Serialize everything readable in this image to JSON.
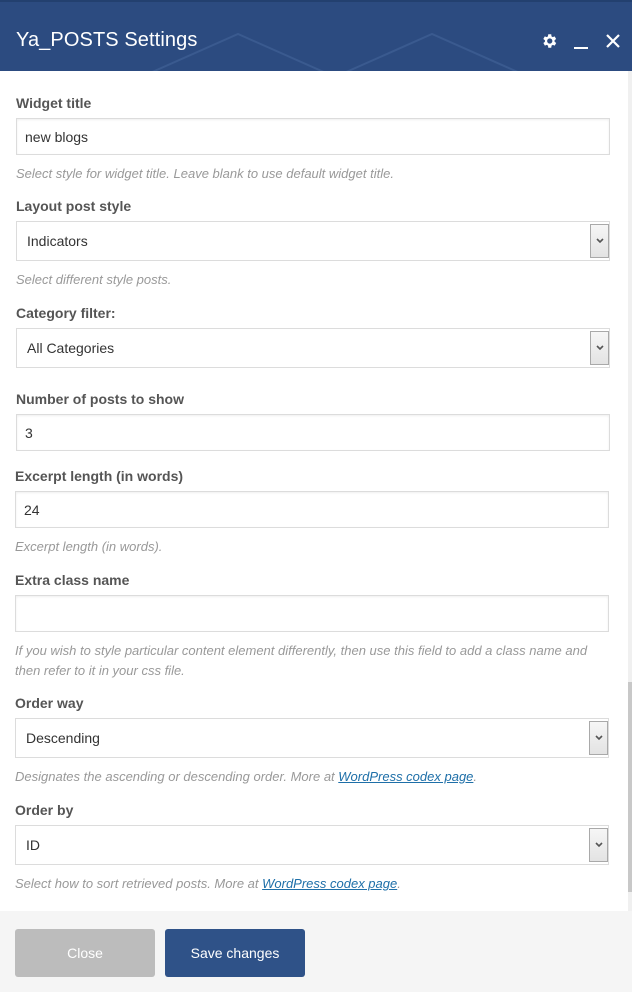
{
  "header": {
    "title": "Ya_POSTS Settings",
    "icons": [
      "gear-icon",
      "minimize-icon",
      "close-icon"
    ],
    "background_color": "#2c4b80"
  },
  "fields": {
    "widget_title": {
      "label": "Widget title",
      "value": "new blogs",
      "help": "Select style for widget title. Leave blank to use default widget title."
    },
    "layout_post_style": {
      "label": "Layout post style",
      "selected": "Indicators",
      "help": "Select different style posts."
    },
    "category_filter": {
      "label": "Category filter:",
      "selected": "All Categories"
    },
    "number_of_posts": {
      "label": "Number of posts to show",
      "value": "3"
    },
    "excerpt_length": {
      "label": "Excerpt length (in words)",
      "value": "24",
      "help": "Excerpt length (in words)."
    },
    "extra_class_name": {
      "label": "Extra class name",
      "value": "",
      "help": "If you wish to style particular content element differently, then use this field to add a class name and then refer to it in your css file."
    },
    "order_way": {
      "label": "Order way",
      "selected": "Descending",
      "help_prefix": "Designates the ascending or descending order. More at ",
      "help_link": "WordPress codex page",
      "help_suffix": "."
    },
    "order_by": {
      "label": "Order by",
      "selected": "ID",
      "help_prefix": "Select how to sort retrieved posts. More at ",
      "help_link": "WordPress codex page",
      "help_suffix": "."
    }
  },
  "footer": {
    "close_label": "Close",
    "save_label": "Save changes",
    "save_color": "#2f5288",
    "close_color": "#bcbcbc"
  }
}
